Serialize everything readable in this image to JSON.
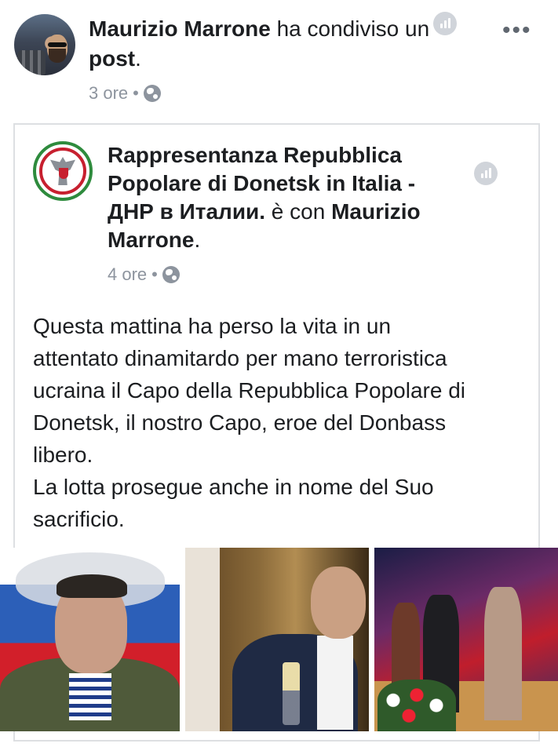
{
  "post": {
    "author": "Maurizio Marrone",
    "action_pre": " ha condiviso un ",
    "action_obj": "post",
    "action_post": ".",
    "time": "3 ore",
    "more_label": "•••"
  },
  "shared": {
    "page_name": "Rappresentanza Repubblica Popolare di Donetsk in Italia - ДНР в Италии.",
    "with_text": " è con ",
    "tagged": "Maurizio Marrone",
    "tagged_post": ".",
    "time": "4 ore",
    "message_lines": [
      "Questa mattina ha perso la vita in un",
      "attentato dinamitardo per mano terroristica",
      "ucraina il Capo della Repubblica Popolare di",
      "Donetsk, il nostro Capo, eroe del Donbass",
      "libero.",
      "La lotta prosegue anche in nome del Suo",
      "sacrificio."
    ]
  },
  "icons": {
    "privacy": "globe-icon",
    "insights": "stats-icon",
    "menu": "more-options-icon"
  },
  "colors": {
    "meta_gray": "#8d949e",
    "text": "#1c1e21",
    "border": "#dddfe2"
  }
}
